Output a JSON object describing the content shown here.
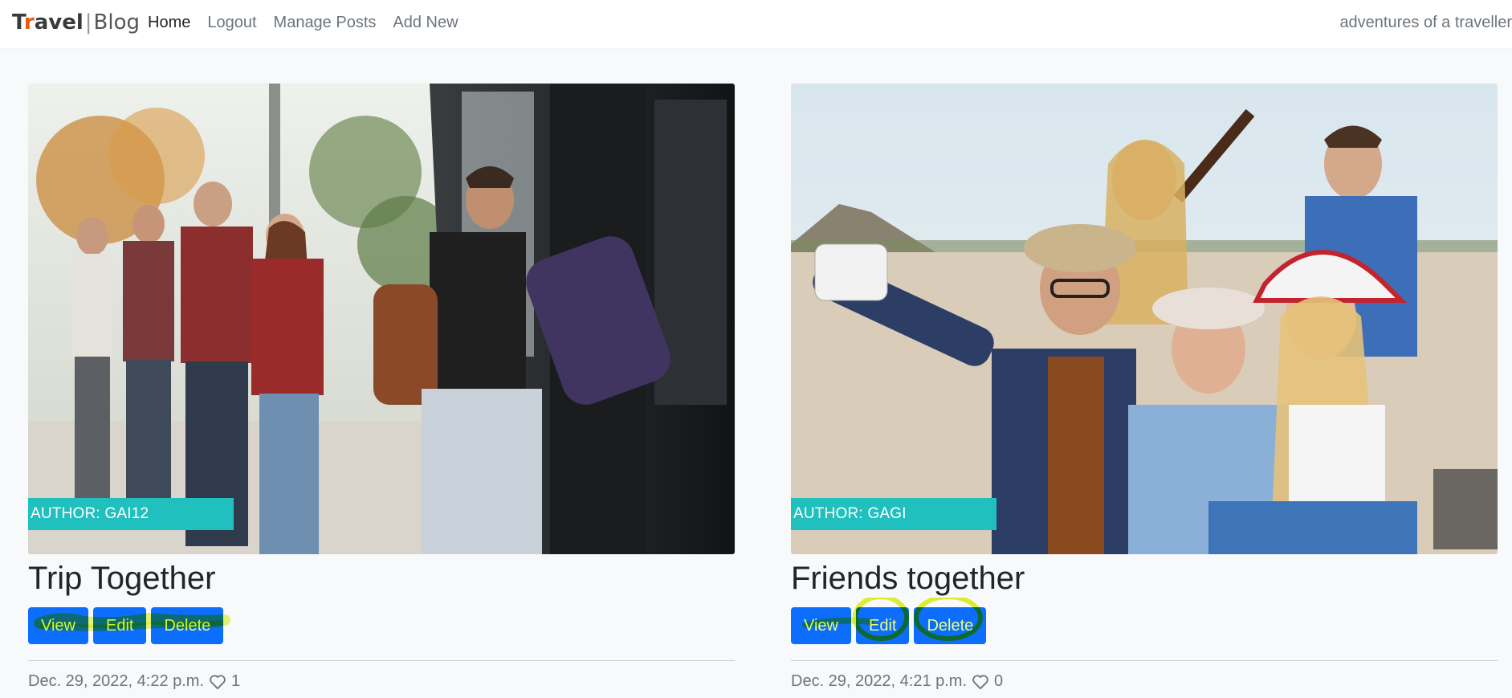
{
  "navbar": {
    "brand_part1_prefix": "T",
    "brand_part1_accent": "r",
    "brand_part1_rest": "avel",
    "brand_separator": "|",
    "brand_part2": "Blog",
    "links": [
      "Home",
      "Logout",
      "Manage Posts",
      "Add New"
    ],
    "active_link": "Home",
    "tagline": "adventures of a traveller"
  },
  "posts": [
    {
      "author_label": "AUTHOR: GAI12",
      "title": "Trip Together",
      "buttons": {
        "view": "View",
        "edit": "Edit",
        "delete": "Delete"
      },
      "date": "Dec. 29, 2022, 4:22 p.m.",
      "likes": "1"
    },
    {
      "author_label": "AUTHOR: GAGI",
      "title": "Friends together",
      "buttons": {
        "view": "View",
        "edit": "Edit",
        "delete": "Delete"
      },
      "date": "Dec. 29, 2022, 4:21 p.m.",
      "likes": "0"
    }
  ],
  "colors": {
    "button_bg": "#0d6efd",
    "author_badge_bg": "#20c0be",
    "highlighter": "#e8ff00",
    "brand_accent": "#e8590c"
  },
  "icons": {
    "likes": "heart-outline-icon"
  }
}
